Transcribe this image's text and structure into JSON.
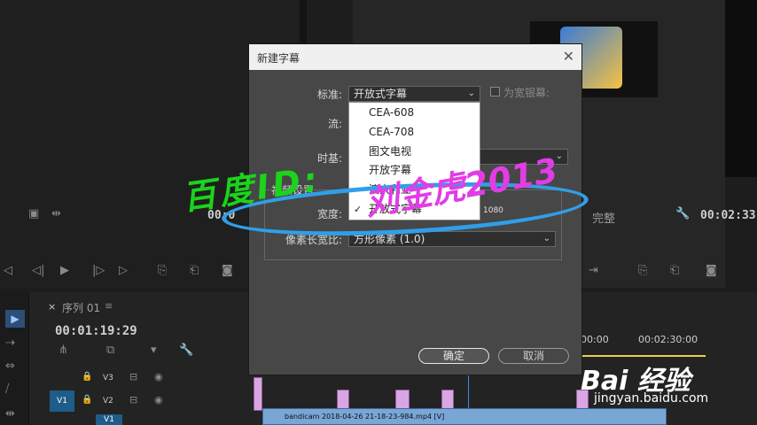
{
  "app": {
    "sequence_title": "序列 01",
    "sequence_timecode": "00:01:19:29",
    "program_timecode_left": "00:0",
    "program_timecode_right": "00:02:33",
    "fit_label": "完整",
    "ruler_left": "00:00",
    "ruler_right": "00:02:30:00",
    "tracks": [
      {
        "name": "V3"
      },
      {
        "name": "V2"
      },
      {
        "name": "V1"
      }
    ],
    "source_target": "V1",
    "clip_name": "bandicam 2018-04-26 21-18-23-984.mp4 [V]"
  },
  "dialog": {
    "title": "新建字幕",
    "close_icon": "close-icon",
    "standard_label": "标准:",
    "standard_value": "开放式字幕",
    "stream_label": "流:",
    "timebase_label": "时基:",
    "widescreen_label": "为宽银幕:",
    "video_settings_label": "视频设置",
    "width_label": "宽度:",
    "width_value": "1080",
    "pixel_aspect_label": "像素长宽比:",
    "pixel_aspect_value": "方形像素 (1.0)",
    "ok_label": "确定",
    "cancel_label": "取消"
  },
  "dropdown": {
    "items": [
      {
        "label": "CEA-608",
        "checked": false
      },
      {
        "label": "CEA-708",
        "checked": false
      },
      {
        "label": "图文电视",
        "checked": false
      },
      {
        "label": "开放字幕",
        "checked": false
      },
      {
        "label": "澳大利亚",
        "checked": false
      },
      {
        "label": "开放式字幕",
        "checked": true
      }
    ]
  },
  "watermark": {
    "text_green": "百度ID:",
    "text_pink": "刘金虎2013"
  },
  "branding": {
    "logo_text": "Bai 经验",
    "site": "jingyan.baidu.com"
  },
  "colors": {
    "dialog_bg": "#474747",
    "accent_blue": "#2f9fe8",
    "watermark_green": "#1bd41b",
    "watermark_pink": "#e23ce6"
  }
}
